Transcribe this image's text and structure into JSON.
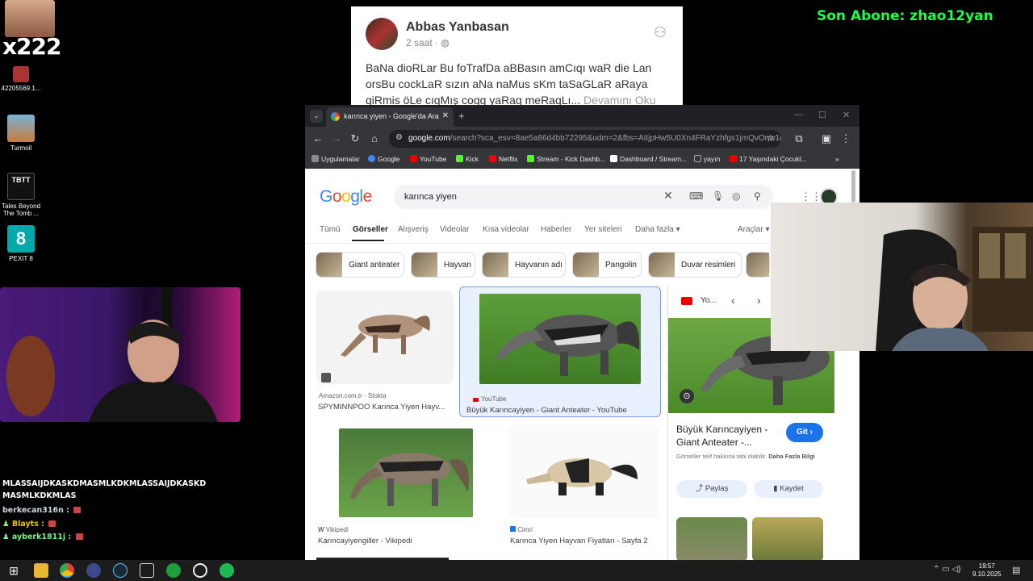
{
  "stream_overlay": {
    "badge_text": "x222",
    "subscriber_label": "Son Abone: zhao12yan"
  },
  "desktop_icons": [
    {
      "label": "42205569.1...",
      "color": "#a33"
    },
    {
      "label": "Turmoil",
      "color": "#c97b3a"
    },
    {
      "label": "Tales Beyond The Tomb ...",
      "color": "#222"
    },
    {
      "label": "PEXIT 8",
      "color": "#0aa"
    }
  ],
  "facebook_post": {
    "author": "Abbas Yanbasan",
    "time": "2 saat · ",
    "text": "BaNa dioRLar Bu foTrafDa aBBasın amCıqı waR die Lan orsBu cockLaR sızın aNa naMus sKm taSaGLaR aRaya qiRmis öLe cıgMış cogg yaRag meRaqLı... ",
    "more": "Devamını Oku"
  },
  "browser": {
    "tab_title": "karınca yiyen - Google'da Ara",
    "url_domain": "google.com",
    "url_path": "/search?sca_esv=8ae5a86d4bb72295&udm=2&fbs=AIIjpHw5U0Xn4FRaYzhfgs1jmQvOnw1d...",
    "bookmarks": [
      {
        "label": "Uygulamalar",
        "color": "#888"
      },
      {
        "label": "Google",
        "color": "#4285f4"
      },
      {
        "label": "YouTube",
        "color": "#e00"
      },
      {
        "label": "Kick",
        "color": "#53fc18"
      },
      {
        "label": "Netflix",
        "color": "#e50914"
      },
      {
        "label": "Stream - Kick Dashb...",
        "color": "#53fc18"
      },
      {
        "label": "Dashboard / Stream...",
        "color": "#fff"
      },
      {
        "label": "yayın",
        "color": "#aaa"
      },
      {
        "label": "17 Yaşındaki Çocukl...",
        "color": "#e00"
      }
    ]
  },
  "google": {
    "logo": "Google",
    "query": "karınca yiyen",
    "tabs": [
      "Tümü",
      "Görseller",
      "Alışveriş",
      "Videolar",
      "Kısa videolar",
      "Haberler",
      "Yer siteleri",
      "Daha fazla ▾",
      "Araçlar ▾"
    ],
    "chips": [
      "Giant anteater",
      "Hayvan",
      "Hayvanın adı",
      "Pangolin",
      "Duvar resimleri"
    ],
    "results": [
      {
        "source": "Amazon.com.tr · Stokta",
        "title": "SPYMINNPOO Karınca Yiyen Hayv..."
      },
      {
        "source": "YouTube",
        "title": "Büyük Karıncayiyen - Giant Anteater - YouTube"
      },
      {
        "source": "Vikipedi",
        "title": "Karıncayiyengiller - Vikipedi"
      },
      {
        "source": "Cimri",
        "title": "Karınca Yiyen Hayvan Fiyatları - Sayfa 2"
      }
    ],
    "side_panel": {
      "source": "Yo...",
      "title": "Büyük Karıncayiyen - Giant Anteater -...",
      "go_button": "Git ›",
      "note_prefix": "Görseller telif hakkına tabi olabilir. ",
      "note_link": "Daha Fazla Bilgi",
      "share": "Paylaş",
      "save": "Kaydet"
    }
  },
  "chat": {
    "message1": "MLASSAIJDKASKDMASMLKDKMLASSAIJDKASKD MASMLKDKMLAS",
    "lines": [
      {
        "user": "berkecan316n :",
        "text": ""
      },
      {
        "user": "Blayts :",
        "text": ""
      },
      {
        "user": "ayberk1811j :",
        "text": ""
      }
    ]
  },
  "taskbar": {
    "time": "19:57",
    "date": "9.10.2025"
  }
}
